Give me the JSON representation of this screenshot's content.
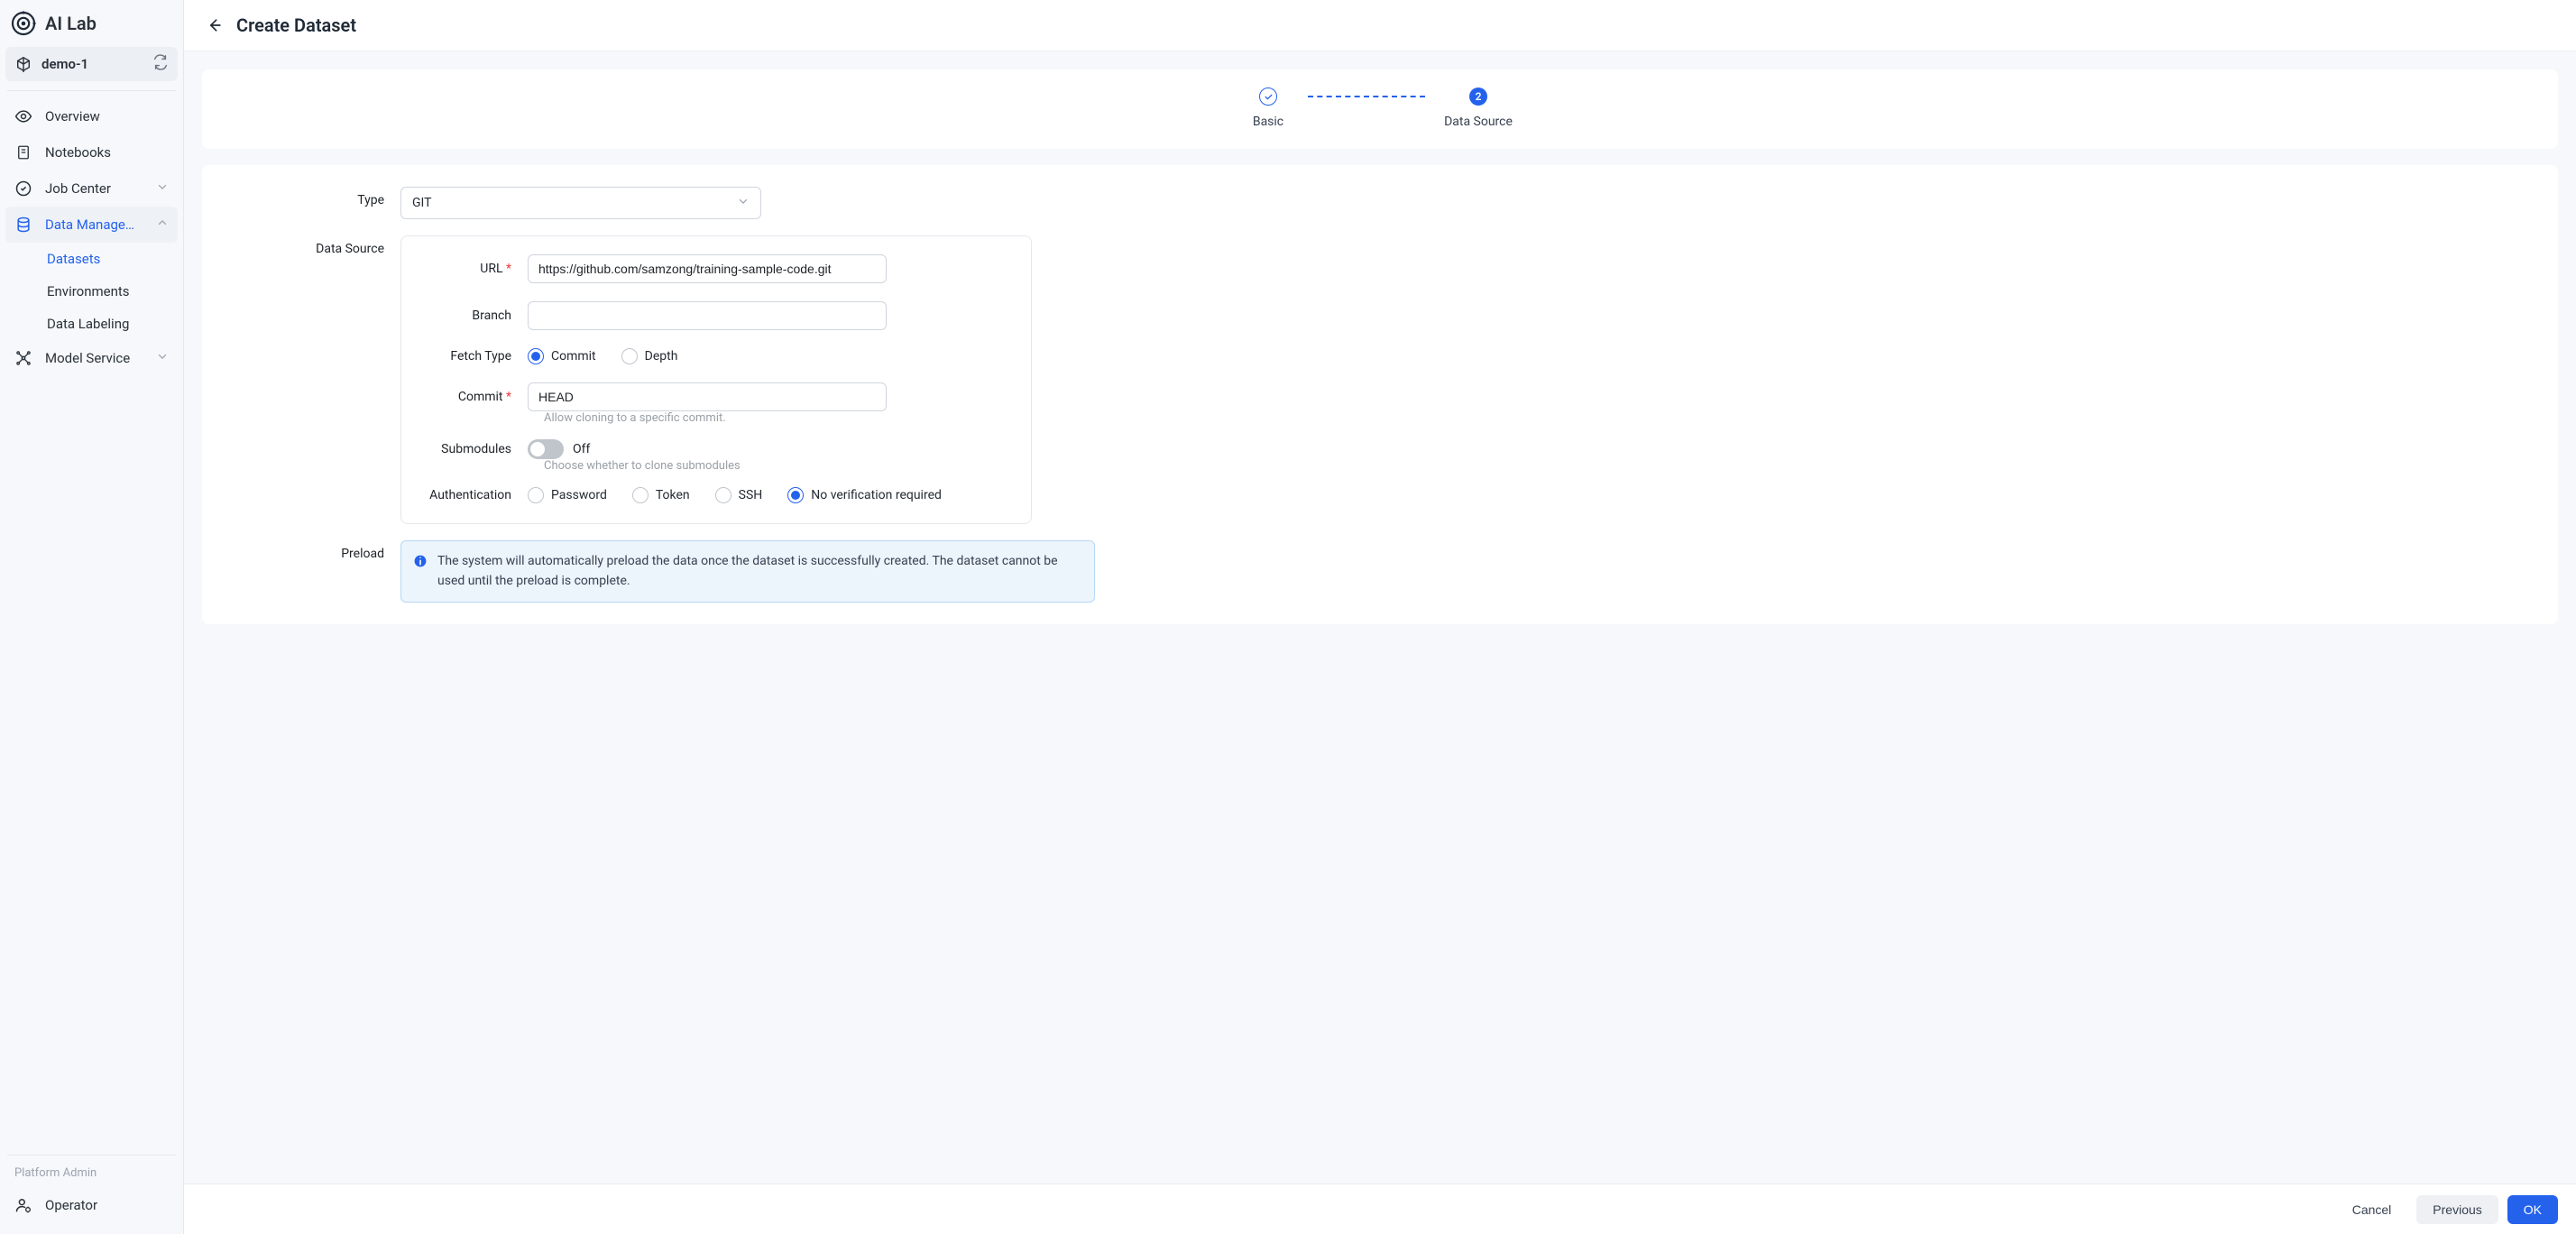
{
  "app": {
    "name": "AI Lab"
  },
  "workspace": {
    "name": "demo-1"
  },
  "sidebar": {
    "items": [
      {
        "label": "Overview"
      },
      {
        "label": "Notebooks"
      },
      {
        "label": "Job Center"
      },
      {
        "label": "Data Manage…"
      },
      {
        "label": "Model Service"
      }
    ],
    "data_management_sub": [
      {
        "label": "Datasets"
      },
      {
        "label": "Environments"
      },
      {
        "label": "Data Labeling"
      }
    ],
    "platform_admin": "Platform Admin",
    "operator": "Operator"
  },
  "page": {
    "title": "Create Dataset"
  },
  "steps": {
    "step1": {
      "label": "Basic"
    },
    "step2": {
      "label": "Data Source",
      "number": "2"
    }
  },
  "form": {
    "type": {
      "label": "Type",
      "value": "GIT"
    },
    "data_source_label": "Data Source",
    "ds": {
      "url": {
        "label": "URL",
        "value": "https://github.com/samzong/training-sample-code.git"
      },
      "branch": {
        "label": "Branch",
        "value": ""
      },
      "fetch_type": {
        "label": "Fetch Type",
        "options": {
          "commit": "Commit",
          "depth": "Depth"
        }
      },
      "commit": {
        "label": "Commit",
        "value": "HEAD",
        "hint": "Allow cloning to a specific commit."
      },
      "submodules": {
        "label": "Submodules",
        "state": "Off",
        "hint": "Choose whether to clone submodules"
      },
      "auth": {
        "label": "Authentication",
        "options": {
          "password": "Password",
          "token": "Token",
          "ssh": "SSH",
          "none": "No verification required"
        }
      }
    },
    "preload": {
      "label": "Preload",
      "message": "The system will automatically preload the data once the dataset is successfully created. The dataset cannot be used until the preload is complete."
    }
  },
  "footer": {
    "cancel": "Cancel",
    "previous": "Previous",
    "ok": "OK"
  }
}
